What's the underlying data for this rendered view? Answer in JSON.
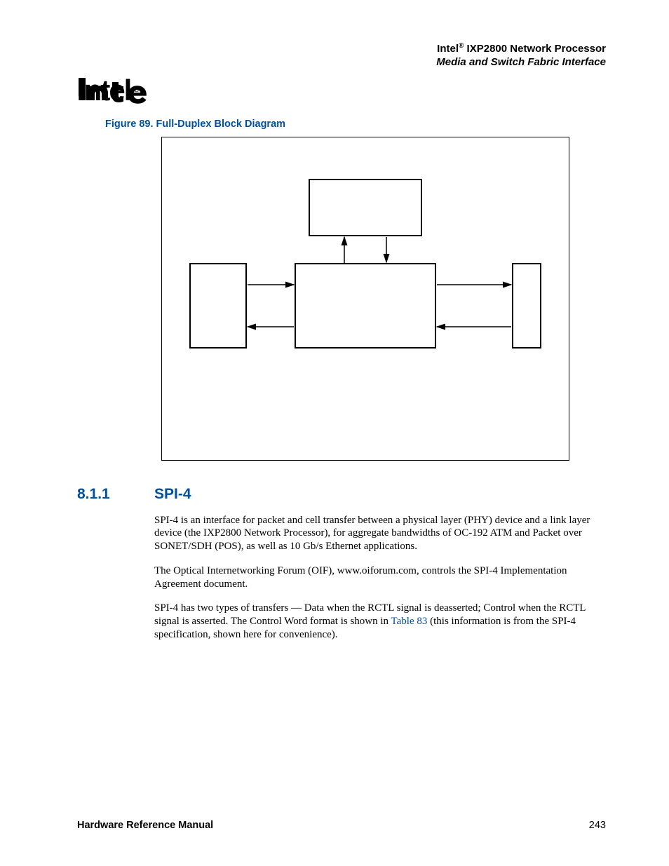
{
  "header": {
    "line1_prefix": "Intel",
    "line1_sup": "®",
    "line1_suffix": " IXP2800 Network Processor",
    "line2": "Media and Switch Fabric Interface"
  },
  "figure": {
    "caption": "Figure 89. Full-Duplex Block Diagram"
  },
  "section": {
    "number": "8.1.1",
    "title": "SPI-4"
  },
  "paragraphs": {
    "p1": "SPI-4 is an interface for packet and cell transfer between a physical layer (PHY) device and a link layer device (the IXP2800 Network Processor), for aggregate bandwidths of OC-192 ATM and Packet over SONET/SDH (POS), as well as 10 Gb/s Ethernet applications.",
    "p2": "The Optical Internetworking Forum (OIF), www.oiforum.com, controls the SPI-4 Implementation Agreement document.",
    "p3a": "SPI-4 has two types of transfers — Data when the RCTL signal is deasserted; Control when the RCTL signal is asserted. The Control Word format is shown in ",
    "p3_ref": "Table 83",
    "p3b": " (this information is from the SPI-4 specification, shown here for convenience)."
  },
  "footer": {
    "left": "Hardware Reference Manual",
    "right": "243"
  }
}
